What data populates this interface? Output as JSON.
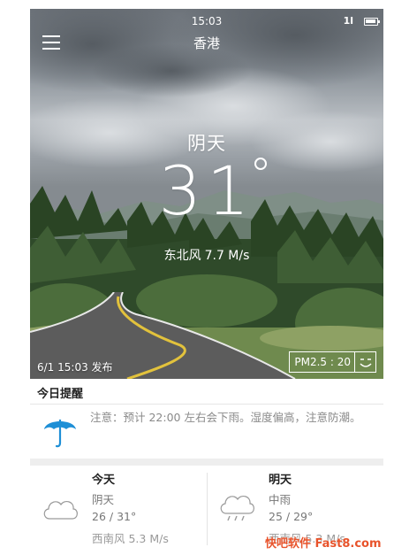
{
  "status_bar": {
    "time": "15:03",
    "signal": "1l"
  },
  "header": {
    "city": "香港"
  },
  "current": {
    "condition": "阴天",
    "temperature": "31",
    "wind_direction": "东北风",
    "wind_speed": "7.7 M/s",
    "published": "6/1 15:03 发布",
    "pm25": "PM2.5 : 20"
  },
  "reminder": {
    "title": "今日提醒",
    "text": "注意：预计 22:00 左右会下雨。湿度偏高，注意防潮。",
    "icon": "umbrella-icon"
  },
  "forecast": [
    {
      "label": "今天",
      "condition": "阴天",
      "temp_range": "26 / 31°",
      "wind": "西南风 5.3 M/s",
      "icon": "cloud-icon"
    },
    {
      "label": "明天",
      "condition": "中雨",
      "temp_range": "25 / 29°",
      "wind": "西南风 5.3 M/s",
      "icon": "rain-cloud-icon"
    }
  ],
  "watermark": "快吧软件 Fast8.com",
  "colors": {
    "accent_blue": "#1e8fd6",
    "text_dark": "#222222",
    "text_muted": "#8a8a8a"
  }
}
